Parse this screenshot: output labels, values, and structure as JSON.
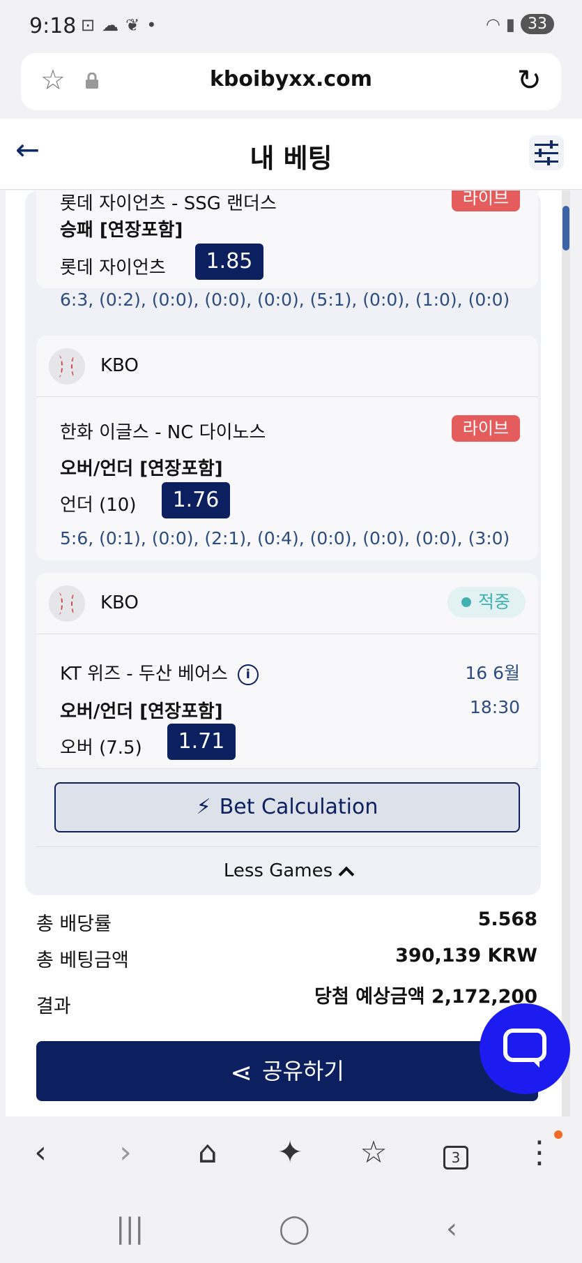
{
  "status_bar": {
    "time": "9:18",
    "battery": "33"
  },
  "browser": {
    "url": "kboibyxx.com"
  },
  "header": {
    "title": "내 베팅"
  },
  "bets": [
    {
      "teams": "롯데 자이언츠 - SSG 랜더스",
      "badge": "라이브",
      "market": "승패 [연장포함]",
      "pick": "롯데 자이언츠",
      "odds": "1.85",
      "scores": "6:3, (0:2), (0:0), (0:0), (0:0), (5:1), (0:0), (1:0), (0:0)"
    },
    {
      "league": "KBO",
      "teams": "한화 이글스 - NC 다이노스",
      "badge": "라이브",
      "market": "오버/언더 [연장포함]",
      "pick": "언더 (10)",
      "odds": "1.76",
      "scores": "5:6, (0:1), (0:0), (2:1), (0:4), (0:0), (0:0), (0:0), (3:0)"
    },
    {
      "league": "KBO",
      "status": "적중",
      "teams": "KT 위즈 - 두산 베어스",
      "date": "16 6월",
      "time": "18:30",
      "market": "오버/언더 [연장포함]",
      "pick": "오버 (7.5)",
      "odds": "1.71"
    }
  ],
  "actions": {
    "bet_calculation": "Bet Calculation",
    "less_games": "Less Games",
    "share": "공유하기"
  },
  "summary": {
    "total_odds_label": "총 배당률",
    "total_odds": "5.568",
    "total_stake_label": "총 베팅금액",
    "total_stake": "390,139 KRW",
    "result_label": "결과",
    "result_value": "당첨 예상금액 2,172,200"
  },
  "icons": {
    "back": "back-arrow-icon",
    "filter": "sliders-icon",
    "chat": "chat-icon",
    "colors": {
      "primary": "#0c1f5e",
      "live": "#e45c5c",
      "win": "#40b0b0",
      "chat": "#1c1cf0"
    }
  }
}
